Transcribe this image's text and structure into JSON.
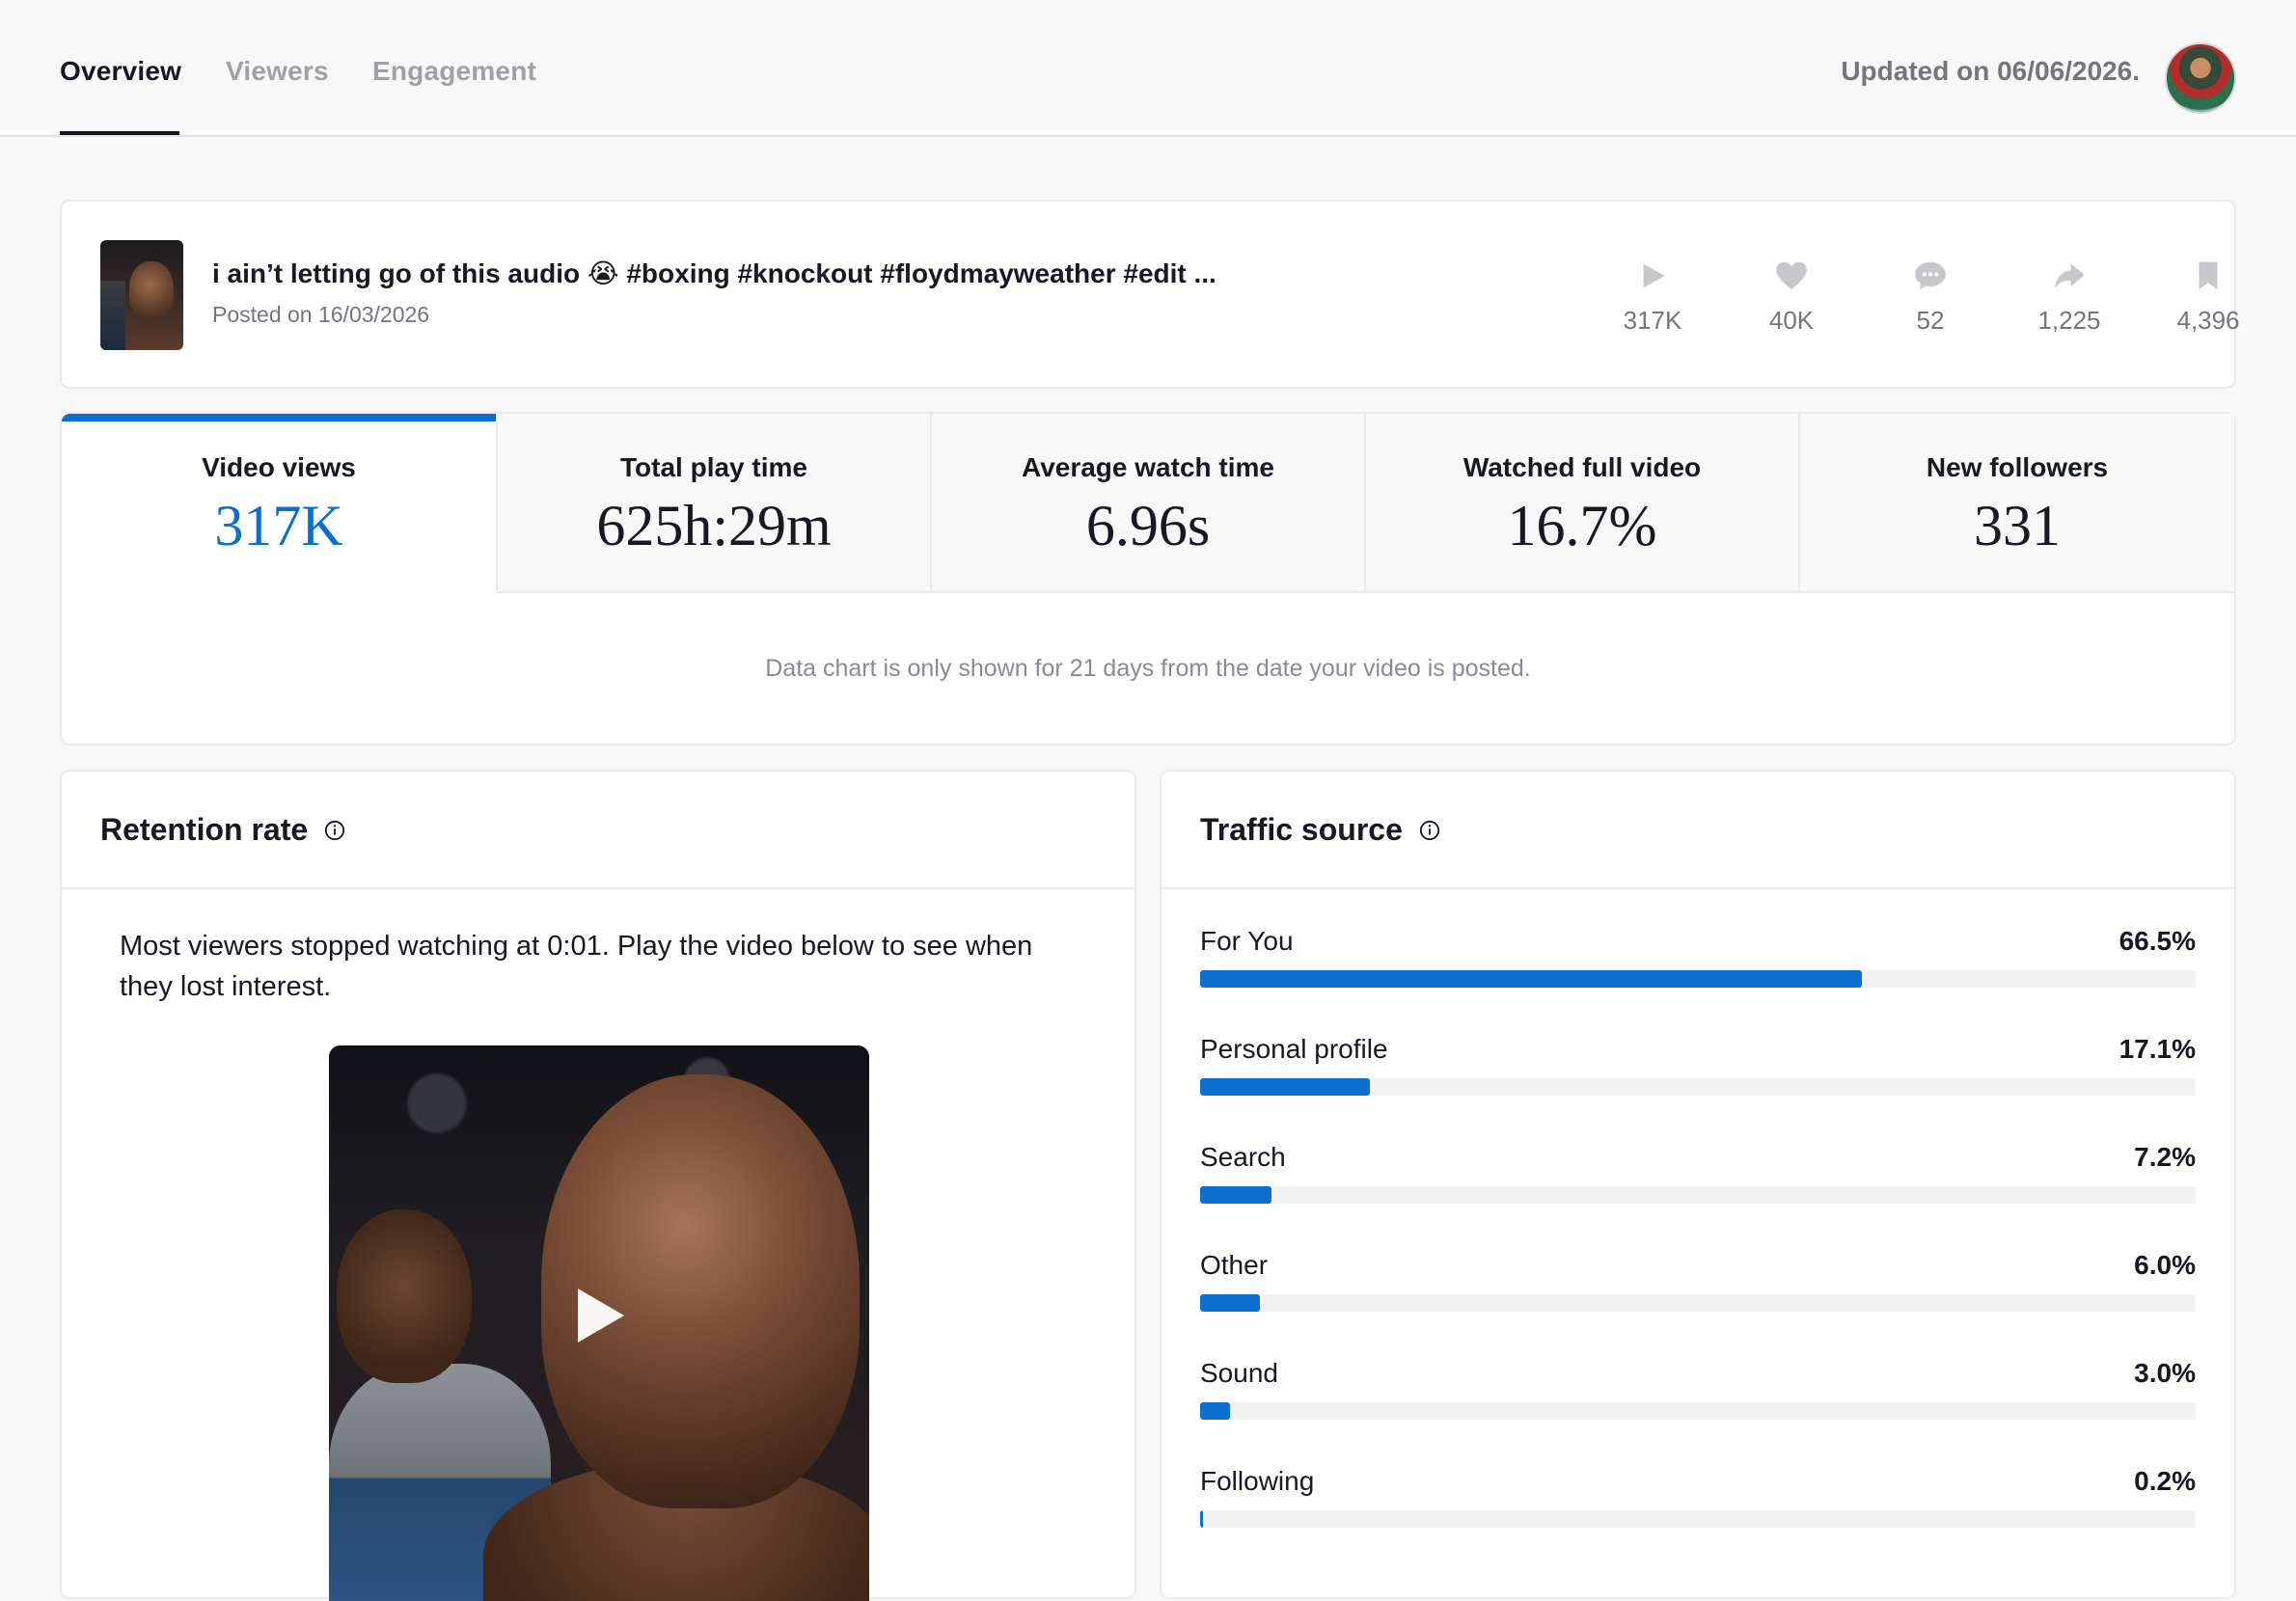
{
  "nav": {
    "tabs": [
      {
        "label": "Overview",
        "active": true
      },
      {
        "label": "Viewers",
        "active": false
      },
      {
        "label": "Engagement",
        "active": false
      }
    ],
    "updated": "Updated on 06/06/2026."
  },
  "video": {
    "title": "i ain’t letting go of this audio 😭 #boxing #knockout #floydmayweather #edit ...",
    "posted": "Posted on 16/03/2026",
    "stats": {
      "views": "317K",
      "likes": "40K",
      "comments": "52",
      "shares": "1,225",
      "saves": "4,396"
    }
  },
  "metrics": [
    {
      "label": "Video views",
      "value": "317K",
      "active": true
    },
    {
      "label": "Total play time",
      "value": "625h:29m",
      "active": false
    },
    {
      "label": "Average watch time",
      "value": "6.96s",
      "active": false
    },
    {
      "label": "Watched full video",
      "value": "16.7%",
      "active": false
    },
    {
      "label": "New followers",
      "value": "331",
      "active": false
    }
  ],
  "chart_note": "Data chart is only shown for 21 days from the date your video is posted.",
  "retention": {
    "title": "Retention rate",
    "text": "Most viewers stopped watching at 0:01. Play the video below to see when they lost interest."
  },
  "traffic": {
    "title": "Traffic source",
    "sources": [
      {
        "name": "For You",
        "pct": "66.5%",
        "value": 66.5
      },
      {
        "name": "Personal profile",
        "pct": "17.1%",
        "value": 17.1
      },
      {
        "name": "Search",
        "pct": "7.2%",
        "value": 7.2
      },
      {
        "name": "Other",
        "pct": "6.0%",
        "value": 6.0
      },
      {
        "name": "Sound",
        "pct": "3.0%",
        "value": 3.0
      },
      {
        "name": "Following",
        "pct": "0.2%",
        "value": 0.2
      }
    ]
  },
  "colors": {
    "accent": "#0b6fcf",
    "track": "#f1f1f2",
    "text": "#161823",
    "muted": "#75757c"
  }
}
